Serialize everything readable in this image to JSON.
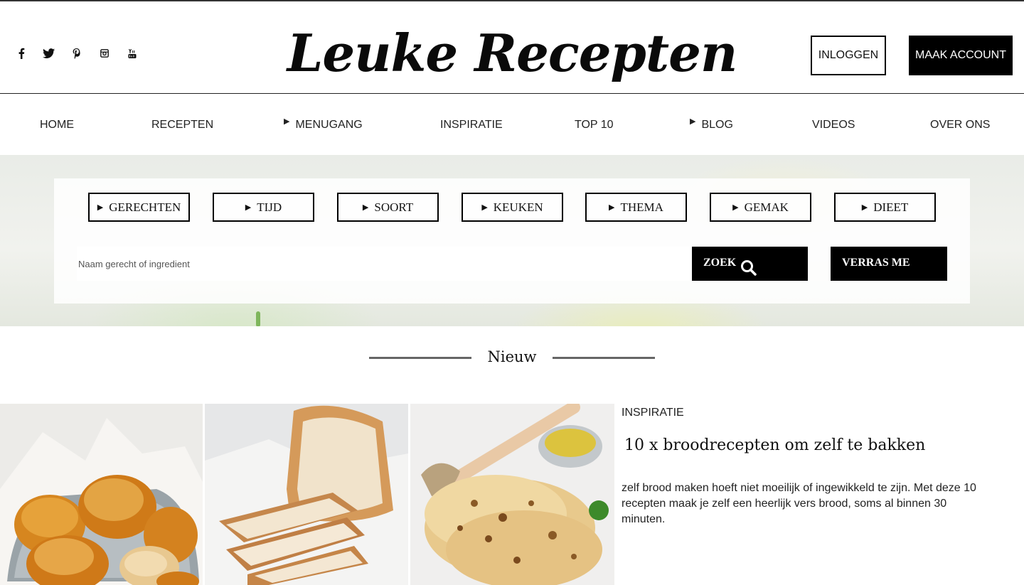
{
  "header": {
    "logo_text": "Leuke Recepten",
    "social_icons": [
      "facebook-icon",
      "twitter-icon",
      "pinterest-icon",
      "instagram-icon",
      "youtube-icon"
    ],
    "login_label": "INLOGGEN",
    "account_label": "MAAK ACCOUNT"
  },
  "nav": {
    "items": [
      {
        "label": "HOME",
        "dropdown": false
      },
      {
        "label": "RECEPTEN",
        "dropdown": false
      },
      {
        "label": "MENUGANG",
        "dropdown": true
      },
      {
        "label": "INSPIRATIE",
        "dropdown": false
      },
      {
        "label": "TOP 10",
        "dropdown": false
      },
      {
        "label": "BLOG",
        "dropdown": true
      },
      {
        "label": "VIDEOS",
        "dropdown": false
      },
      {
        "label": "OVER ONS",
        "dropdown": false
      }
    ]
  },
  "search": {
    "filters": [
      "GERECHTEN",
      "TIJD",
      "SOORT",
      "KEUKEN",
      "THEMA",
      "GEMAK",
      "DIEET"
    ],
    "placeholder": "Naam gerecht of ingredient",
    "search_label": "ZOEK",
    "surprise_label": "VERRAS ME"
  },
  "section": {
    "title": "Nieuw"
  },
  "article": {
    "category": "INSPIRATIE",
    "title": "10 x broodrecepten om zelf te bakken",
    "text": "zelf brood maken hoeft niet moeilijk of ingewikkeld te zijn. Met deze 10 recepten maak je zelf een heerlijk vers brood, soms al binnen 30 minuten.",
    "images": [
      "bread-rolls-photo",
      "white-bread-loaf-photo",
      "naan-flatbread-photo"
    ]
  },
  "colors": {
    "black": "#000000",
    "text": "#222222",
    "divider": "#666666"
  }
}
